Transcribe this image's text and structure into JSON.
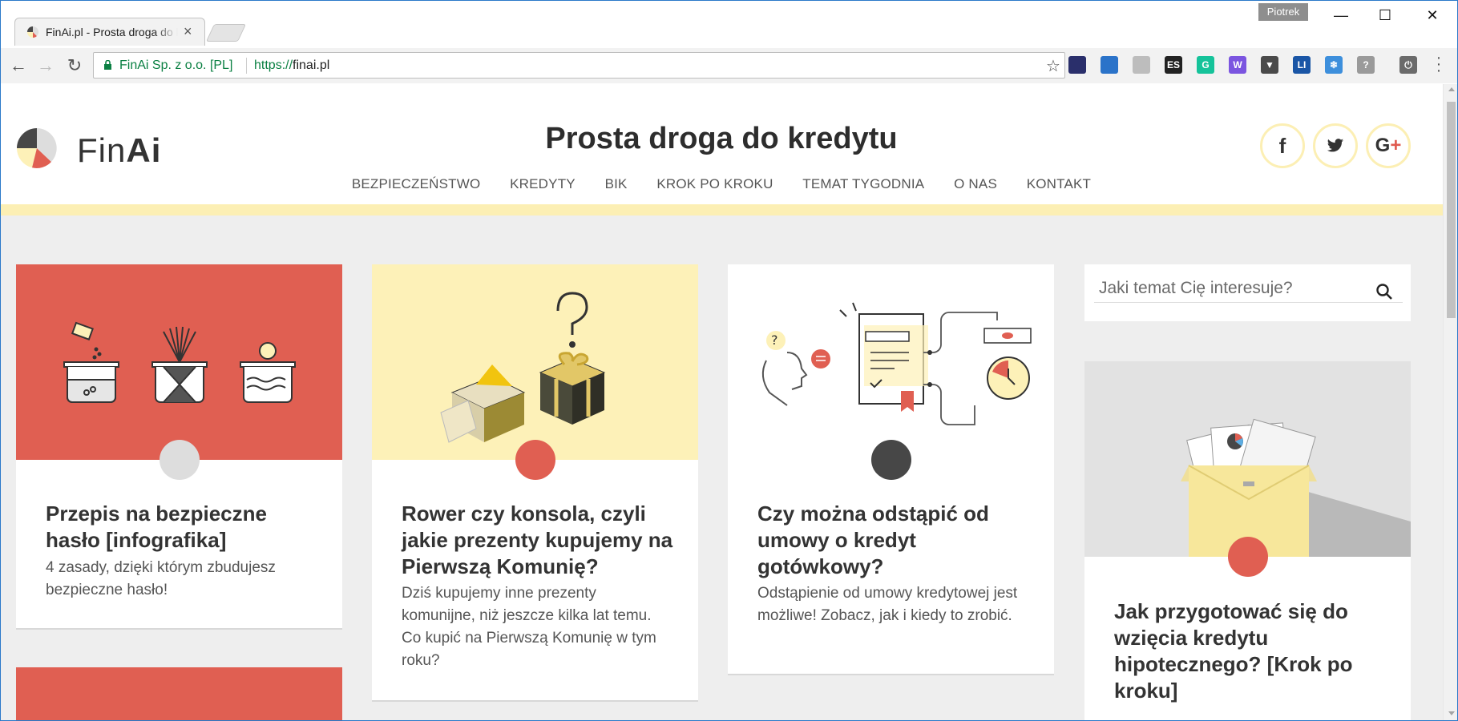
{
  "browser": {
    "tab_title": "FinAi.pl - Prosta droga do kredytu",
    "tab_close": "×",
    "profile_name": "Piotrek",
    "certificate_label": "FinAi Sp. z o.o. [PL]",
    "url_scheme": "https://",
    "url_host": "finai.pl",
    "window_controls": {
      "minimize": "—",
      "maximize": "☐",
      "close": "✕"
    },
    "extensions": [
      {
        "name": "ext-speedometer-icon",
        "label": "",
        "color": "#2a2f6b"
      },
      {
        "name": "ext-screenshot-icon",
        "label": "",
        "color": "#2b73c9"
      },
      {
        "name": "ext-gear-icon",
        "label": "",
        "color": "#bdbdbd"
      },
      {
        "name": "ext-es-icon",
        "label": "ES",
        "color": "#222222"
      },
      {
        "name": "ext-grammarly-icon",
        "label": "G",
        "color": "#15c39a"
      },
      {
        "name": "ext-w-icon",
        "label": "W",
        "color": "#7b55e0"
      },
      {
        "name": "ext-vue-icon",
        "label": "▼",
        "color": "#4a4a4a"
      },
      {
        "name": "ext-li-icon",
        "label": "LI",
        "color": "#1a56a6"
      },
      {
        "name": "ext-snowflake-icon",
        "label": "❄",
        "color": "#3d8fdc"
      },
      {
        "name": "ext-help-icon",
        "label": "?",
        "color": "#9a9a9a"
      },
      {
        "name": "ext-timer-icon",
        "label": "⏻",
        "color": "#6b6b6b"
      }
    ]
  },
  "site": {
    "logo_fin": "Fin",
    "logo_ai": "Ai",
    "title": "Prosta droga do kredytu",
    "nav": [
      "BEZPIECZEŃSTWO",
      "KREDYTY",
      "BIK",
      "KROK PO KROKU",
      "TEMAT TYGODNIA",
      "O NAS",
      "KONTAKT"
    ],
    "social": {
      "facebook": "f",
      "twitter": "🐦",
      "googleplus": "G",
      "googleplus_plus": "+"
    },
    "search_placeholder": "Jaki temat Cię interesuje?",
    "colors": {
      "red": "#e05f52",
      "yellow": "#fcefb4",
      "dark": "#474747",
      "grey_dot": "#dddddd"
    }
  },
  "cards": [
    {
      "title": "Przepis na bezpieczne hasło [infografika]",
      "text": "4 zasady, dzięki którym zbudujesz bezpieczne hasło!",
      "image_bg": "#e05f52",
      "dot_color": "#dddddd"
    },
    {
      "title": "Rower czy konsola, czyli jakie prezenty kupujemy na Pierwszą Komunię?",
      "text": "Dziś kupujemy inne prezenty komunijne, niż jeszcze kilka lat temu. Co kupić na Pierwszą Komunię w tym roku?",
      "image_bg": "#fdf1b8",
      "dot_color": "#e05f52"
    },
    {
      "title": "Czy można odstąpić od umowy o kredyt gotówkowy?",
      "text": "Odstąpienie od umowy kredytowej jest możliwe! Zobacz, jak i kiedy to zrobić.",
      "image_bg": "#ffffff",
      "dot_color": "#474747"
    },
    {
      "title": "Jak przygotować się do wzięcia kredytu hipotecznego? [Krok po kroku]",
      "text": "",
      "image_bg": "#e2e2e2",
      "dot_color": "#e05f52"
    },
    {
      "title": "",
      "text": "",
      "image_bg": "#e05f52",
      "dot_color": ""
    }
  ]
}
